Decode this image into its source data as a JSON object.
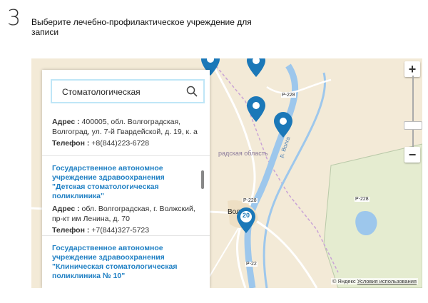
{
  "step": {
    "number": "3",
    "title": "Выберите лечебно-профилактическое учреждение для записи"
  },
  "search": {
    "query": "Стоматологическая"
  },
  "results": [
    {
      "address_label": "Адрес :",
      "address": "400005, обл. Волгоградская, Волгоград, ул. 7-й Гвардейской, д. 19, к. а",
      "phone_label": "Телефон :",
      "phone": "+8(844)223-6728"
    },
    {
      "name": "Государственное автономное учреждение здравоохранения \"Детская стоматологическая поликлиника\"",
      "address_label": "Адрес :",
      "address": "обл. Волгоградская, г. Волжский, пр-кт им Ленина, д. 70",
      "phone_label": "Телефон :",
      "phone": "+7(844)327-5723"
    },
    {
      "name": "Государственное автономное учреждение здравоохранения \"Клиническая стоматологическая поликлиника № 10\""
    }
  ],
  "map": {
    "cluster_count": "20",
    "city_label": "Вол    ад",
    "region_label": "радская область",
    "copyright_text": "© Яндекс",
    "terms_link": "Условия использования",
    "road_labels": [
      "Р-228",
      "Р-228",
      "Р-228",
      "Р-22"
    ],
    "river_label": "р. Волга"
  },
  "zoom": {
    "in_label": "+",
    "out_label": "−"
  },
  "colors": {
    "pin": "#1b78b8",
    "link": "#1e7fc3",
    "road": "#ffffff",
    "water": "#9dc7ec"
  }
}
